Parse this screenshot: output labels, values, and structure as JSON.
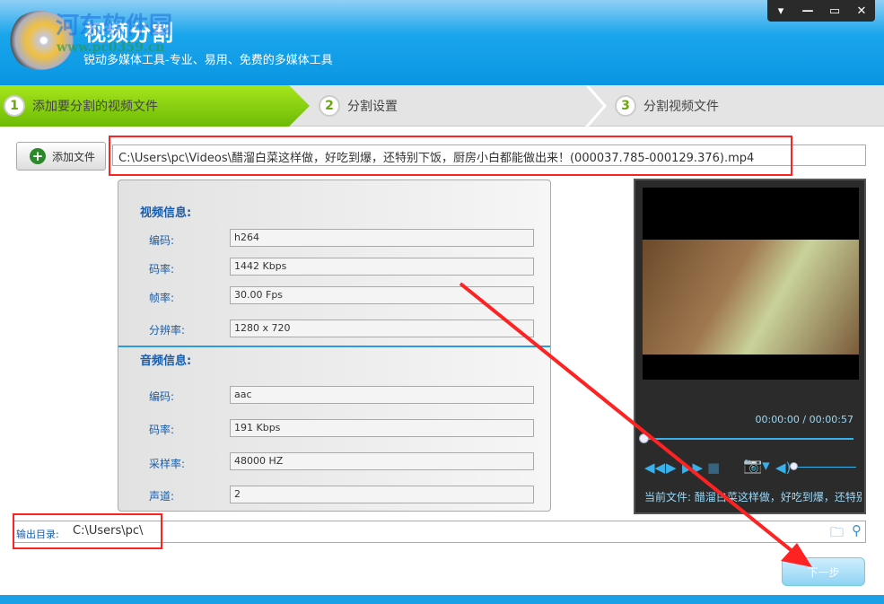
{
  "header": {
    "title": "视频分割",
    "subtitle": "锐动多媒体工具-专业、易用、免费的多媒体工具",
    "watermark": "河东软件园",
    "watermark_url": "www.pc0359.cn"
  },
  "window": {
    "buttons": [
      "▾",
      "—",
      "▭",
      "✕"
    ]
  },
  "steps": [
    {
      "num": "1",
      "label": "添加要分割的视频文件"
    },
    {
      "num": "2",
      "label": "分割设置"
    },
    {
      "num": "3",
      "label": "分割视频文件"
    }
  ],
  "add_file": {
    "icon": "plus-icon",
    "label": "添加文件"
  },
  "file_path": "C:\\Users\\pc\\Videos\\醋溜白菜这样做，好吃到爆，还特别下饭，厨房小白都能做出来！(000037.785-000129.376).mp4",
  "video_info": {
    "title": "视频信息:",
    "fields": [
      {
        "label": "编码:",
        "value": "h264"
      },
      {
        "label": "码率:",
        "value": "1442 Kbps"
      },
      {
        "label": "帧率:",
        "value": "30.00 Fps"
      },
      {
        "label": "分辨率:",
        "value": "1280 x 720"
      }
    ]
  },
  "audio_info": {
    "title": "音频信息:",
    "fields": [
      {
        "label": "编码:",
        "value": "aac"
      },
      {
        "label": "码率:",
        "value": "191 Kbps"
      },
      {
        "label": "采样率:",
        "value": "48000 HZ"
      },
      {
        "label": "声道:",
        "value": "2"
      }
    ]
  },
  "player": {
    "time": "00:00:00 / 00:00:57",
    "progress": 0,
    "volume": 0,
    "current_file": "当前文件: 醋溜白菜这样做，好吃到爆，还特别下饭"
  },
  "output": {
    "label": "输出目录:",
    "value": "C:\\Users\\pc\\"
  },
  "next_label": "下一步",
  "colors": {
    "accent": "#1aa6ec",
    "step_active": "#8fd414",
    "annotation": "#ff2222"
  }
}
